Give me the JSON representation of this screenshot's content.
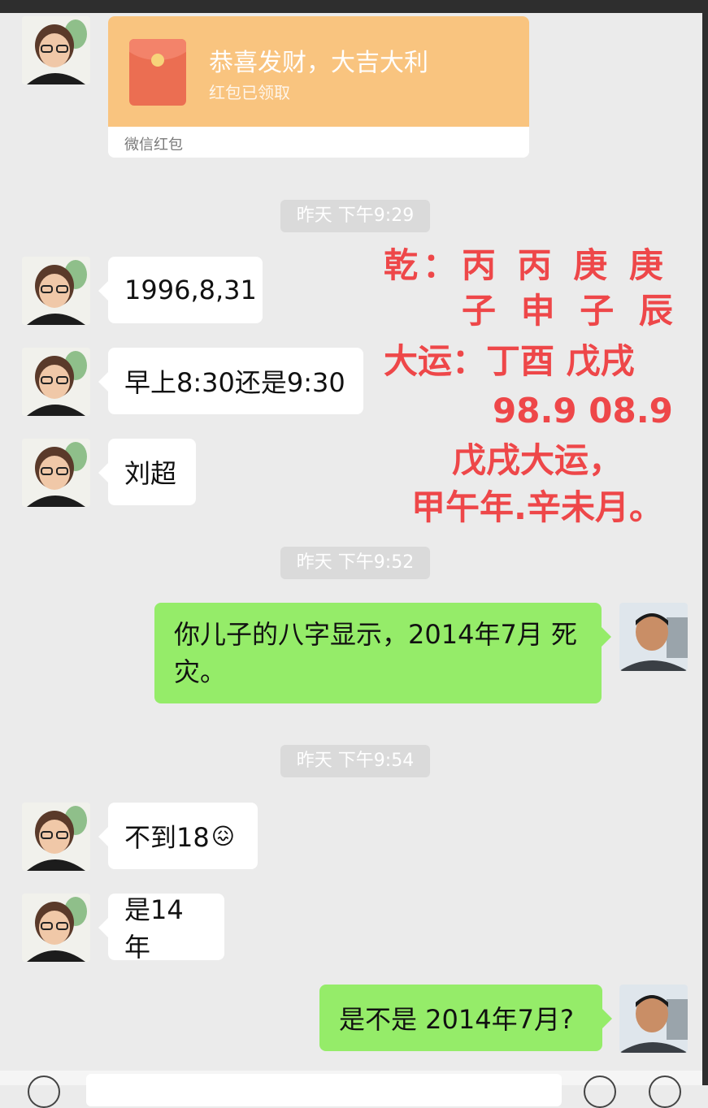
{
  "red_packet": {
    "title": "恭喜发财，大吉大利",
    "status": "红包已领取",
    "label": "微信红包"
  },
  "timestamps": [
    "昨天 下午9:29",
    "昨天 下午9:52",
    "昨天 下午9:54"
  ],
  "messages": {
    "m1": "1996,8,31",
    "m2": "早上8:30还是9:30",
    "m3": "刘超",
    "m4": "你儿子的八字显示，2014年7月 死灾。",
    "m5": "不到18",
    "m5_emoji": "😖",
    "m6": "是14年",
    "m7": "是不是 2014年7月?"
  },
  "overlay_lines": [
    "乾：丙 丙 庚 庚",
    "子 申 子 辰",
    "大运：丁酉 戊戌",
    "98.9 08.9",
    "戊戌大运，",
    "甲午年.辛未月。"
  ],
  "colors": {
    "chat_background": "#ebebeb",
    "incoming_bubble": "#ffffff",
    "outgoing_bubble": "#95ec69",
    "overlay_text": "#ee4749",
    "red_packet": "#f9c47f"
  },
  "icons": {
    "contact_avatar": "woman-with-glasses-avatar",
    "self_avatar": "man-avatar",
    "red_packet_icon": "red-envelope-icon"
  }
}
